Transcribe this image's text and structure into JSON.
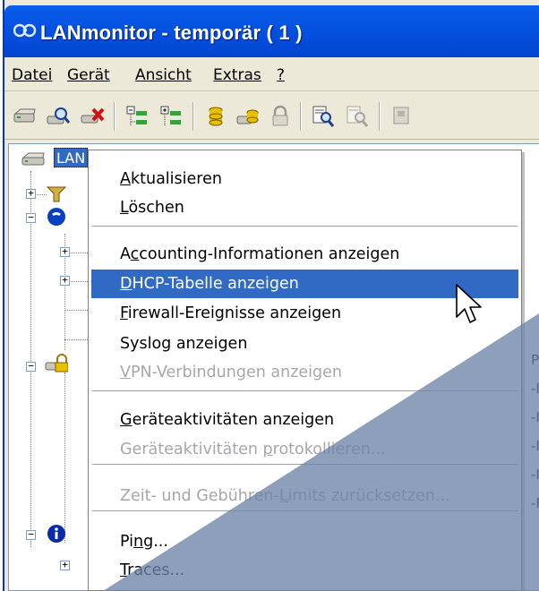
{
  "window": {
    "title": "LANmonitor - temporär ( 1 )"
  },
  "menubar": {
    "items": [
      {
        "label": "Datei"
      },
      {
        "label": "Gerät"
      },
      {
        "label": "Ansicht"
      },
      {
        "label": "Extras"
      },
      {
        "label": "?"
      }
    ]
  },
  "toolbar": {
    "buttons": [
      "refresh-device-icon",
      "search-device-icon",
      "delete-device-icon",
      "collapse-tree-icon",
      "expand-tree-icon",
      "database-icon",
      "accounting-icon",
      "lock-icon",
      "find-icon",
      "find-next-icon",
      "settings-icon"
    ]
  },
  "tree": {
    "root_label": "LAN",
    "right_column": [
      "P",
      "-I",
      "-I",
      "-I",
      "-I",
      "-F"
    ]
  },
  "context_menu": {
    "items": [
      {
        "pre": "",
        "u": "A",
        "post": "ktualisieren",
        "state": "normal"
      },
      {
        "pre": "",
        "u": "L",
        "post": "öschen",
        "state": "normal"
      },
      {
        "sep": true
      },
      {
        "pre": "A",
        "u": "c",
        "post": "counting-Informationen anzeigen",
        "state": "normal"
      },
      {
        "pre": "",
        "u": "D",
        "post": "HCP-Tabelle anzeigen",
        "state": "selected"
      },
      {
        "pre": "",
        "u": "F",
        "post": "irewall-Ereignisse anzeigen",
        "state": "normal"
      },
      {
        "pre": "Syslog anzeigen",
        "u": "",
        "post": "",
        "state": "normal"
      },
      {
        "pre": "",
        "u": "V",
        "post": "PN-Verbindungen anzeigen",
        "state": "disabled"
      },
      {
        "sep": true
      },
      {
        "pre": "",
        "u": "G",
        "post": "eräteaktivitäten anzeigen",
        "state": "normal"
      },
      {
        "pre": "Geräteaktivitäten ",
        "u": "p",
        "post": "rotokollieren...",
        "state": "disabled"
      },
      {
        "sep": true
      },
      {
        "pre": "Zeit- und Gebühren-",
        "u": "L",
        "post": "imits zurücksetzen...",
        "state": "disabled"
      },
      {
        "sep": true
      },
      {
        "pre": "Pi",
        "u": "n",
        "post": "g...",
        "state": "normal"
      },
      {
        "pre": "",
        "u": "T",
        "post": "races...",
        "state": "normal"
      }
    ]
  },
  "colors": {
    "titlebar": "#0553e2",
    "selection": "#316ac5",
    "overlay": "#6d84a8"
  }
}
